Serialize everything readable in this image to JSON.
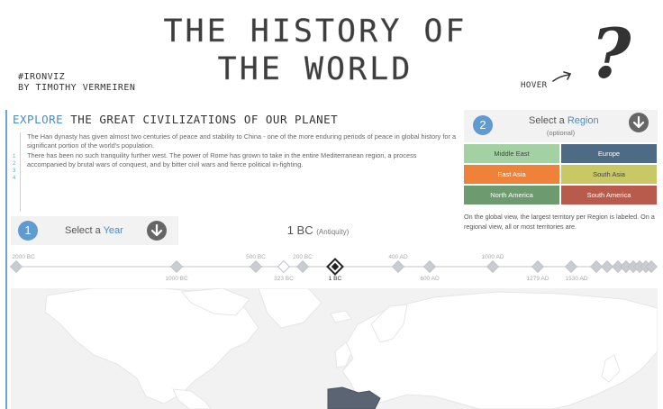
{
  "header": {
    "title_line1": "THE HISTORY OF",
    "title_line2": "THE WORLD",
    "hashtag": "#IRONVIZ",
    "author": "BY TIMOTHY VERMEIREN",
    "hover_label": "HOVER",
    "help_symbol": "?"
  },
  "explore": {
    "prefix": "EXPLORE",
    "rest": "THE GREAT CIVILIZATIONS OF OUR PLANET",
    "paragraphs": [
      "The Han dynasty has given almost two centuries of peace and stability to China - one of the more enduring periods of peace in global history for a significant portion of the world's population.",
      "There has been no such tranquility further west. The power of Rome has grown to take in the entire Mediterranean region, a process accompanied by brutal wars of conquest, and by bitter civil wars and fierce political in-fighting."
    ]
  },
  "year_selector": {
    "step": "1",
    "label_prefix": "Select a",
    "label_highlight": "Year",
    "dropdown_icon": "chevron-down-icon",
    "current_year": "1 BC",
    "current_era": "(Antiquity)"
  },
  "region_selector": {
    "step": "2",
    "label_prefix": "Select a",
    "label_highlight": "Region",
    "optional": "(optional)",
    "regions": [
      {
        "label": "Middle East",
        "color": "#a3d1a3",
        "text_color": "#444"
      },
      {
        "label": "Europe",
        "color": "#4e6b86",
        "text_color": "#fff"
      },
      {
        "label": "East Asia",
        "color": "#f08138",
        "text_color": "#fff"
      },
      {
        "label": "South Asia",
        "color": "#c8c964",
        "text_color": "#444"
      },
      {
        "label": "North America",
        "color": "#6d9a6f",
        "text_color": "#fff"
      },
      {
        "label": "South America",
        "color": "#b85b4c",
        "text_color": "#fff"
      }
    ],
    "note": "On the global view, the largest territory per Region is labeled. On a regional view, all or most territories are."
  },
  "timeline": {
    "top_labels": [
      "2000 BC",
      "500 BC",
      "200 BC",
      "400 AD",
      "1000 AD"
    ],
    "bottom_labels": [
      "1000 BC",
      "323 BC",
      "1 BC",
      "600 AD",
      "1279 AD",
      "1530 AD"
    ],
    "selected": "1 BC"
  },
  "colors": {
    "accent": "#4a8cc4",
    "panel_bg": "#f2f2f2",
    "map_land": "#ffffff",
    "map_highlight": "#5b6472"
  }
}
